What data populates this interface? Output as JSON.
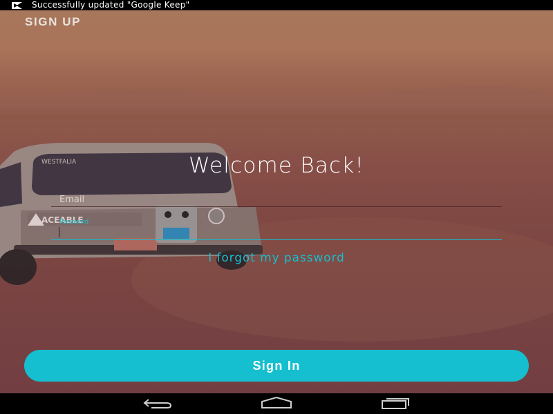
{
  "status_bar": {
    "notification_icon": "update-icon",
    "notification_text": "Successfully updated \"Google Keep\""
  },
  "header": {
    "sign_up_label": "SIGN UP"
  },
  "main": {
    "welcome_title": "Welcome Back!",
    "email": {
      "placeholder": "Email",
      "value": ""
    },
    "password": {
      "label": "Password",
      "value": ""
    },
    "forgot_password_link": "I forgot my password",
    "sign_in_button": "Sign In"
  },
  "nav_bar": {
    "back_icon": "back-icon",
    "home_icon": "home-icon",
    "recents_icon": "recents-icon"
  },
  "colors": {
    "accent": "#15bfcf",
    "background_top": "#a8765a",
    "background_bottom": "#733e42"
  }
}
